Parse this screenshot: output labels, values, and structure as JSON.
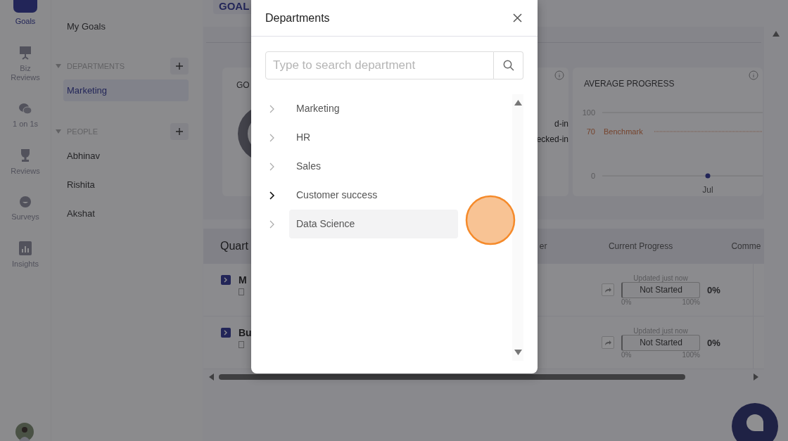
{
  "nav_rail": [
    {
      "label": "Goals",
      "selected": true
    },
    {
      "label": "Biz Reviews",
      "selected": false
    },
    {
      "label": "1 on 1s",
      "selected": false
    },
    {
      "label": "Reviews",
      "selected": false
    },
    {
      "label": "Surveys",
      "selected": false
    },
    {
      "label": "Insights",
      "selected": false
    }
  ],
  "sidebar": {
    "top_item": "My Goals",
    "sections": [
      {
        "title": "DEPARTMENTS",
        "expanded": true,
        "items": [
          {
            "label": "Marketing",
            "selected": true
          }
        ]
      },
      {
        "title": "PEOPLE",
        "expanded": true,
        "items": [
          {
            "label": "Abhinav",
            "selected": false
          },
          {
            "label": "Rishita",
            "selected": false
          },
          {
            "label": "Akshat",
            "selected": false
          }
        ]
      }
    ]
  },
  "main": {
    "tab": "GOAL",
    "cards": [
      {
        "kind": "donut",
        "title": "GO"
      },
      {
        "kind": "legend",
        "lines": [
          "d-in",
          "ecked-in"
        ]
      },
      {
        "kind": "chart",
        "chart_data": {
          "type": "line",
          "title": "AVERAGE PROGRESS",
          "categories": [
            "Jul"
          ],
          "values": [
            0
          ],
          "marker": "circle",
          "ylim": [
            0,
            100
          ],
          "yticks": [
            0,
            70,
            100
          ],
          "ref_lines": [
            {
              "axis": "y",
              "value": 70,
              "label": "Benchmark"
            }
          ]
        }
      }
    ],
    "table": {
      "columns": [
        "Quart",
        "er",
        "Current Progress",
        "Comme"
      ],
      "rows": [
        {
          "title": "M",
          "updated": "Updated just now",
          "status": "Not Started",
          "percent": "0%",
          "scale_min": "0%",
          "scale_max": "100%"
        },
        {
          "title": "Bu",
          "updated": "Updated just now",
          "status": "Not Started",
          "percent": "0%",
          "scale_min": "0%",
          "scale_max": "100%"
        }
      ]
    }
  },
  "modal": {
    "title": "Departments",
    "search": {
      "placeholder": "Type to search department"
    },
    "items": [
      {
        "label": "Marketing",
        "selected": false,
        "hovered": false
      },
      {
        "label": "HR",
        "selected": false,
        "hovered": false
      },
      {
        "label": "Sales",
        "selected": false,
        "hovered": false
      },
      {
        "label": "Customer success",
        "selected": false,
        "hovered": true
      },
      {
        "label": "Data Science",
        "selected": true,
        "hovered": false
      }
    ]
  }
}
